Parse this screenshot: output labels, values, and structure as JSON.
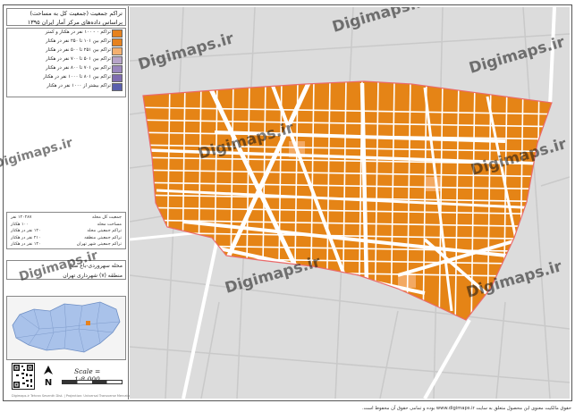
{
  "title": {
    "line1": "تراکم جمعیت (جمعیت کل به مساحت)",
    "line2": "براساس داده‌های مرکز آمار ایران ۱۳۹۵"
  },
  "legend": [
    {
      "label": "تراکم ۰ - ۱۰۰ نفر در هکتار و کمتر",
      "color": "#e6821e"
    },
    {
      "label": "تراکم بین ۱۰۱ تا ۲۵۰ نفر در هکتار",
      "color": "#e6821e"
    },
    {
      "label": "تراکم بین ۲۵۱ تا ۵۰۰ نفر در هکتار",
      "color": "#f3b070"
    },
    {
      "label": "تراکم بین ۵۰۱ تا ۷۰۰ نفر در هکتار",
      "color": "#b7a4c9"
    },
    {
      "label": "تراکم بین ۷۰۱ تا ۸۰۰ نفر در هکتار",
      "color": "#9a86bd"
    },
    {
      "label": "تراکم بین ۸۰۱ تا ۱۰۰۰ نفر در هکتار",
      "color": "#7f6cb0"
    },
    {
      "label": "تراکم بیشتر از ۱۰۰۰ نفر در هکتار",
      "color": "#5a5fad"
    }
  ],
  "stats": [
    {
      "label": "جمعیت کل محله",
      "value": "۱۲۰۲۸۷ نفر"
    },
    {
      "label": "مساحت محله",
      "value": "۱۰۰ هکتار"
    },
    {
      "label": "تراکم جمعیتی محله",
      "value": "۱۲۰ نفر در هکتار"
    },
    {
      "label": "تراکم جمعیتی منطقه",
      "value": "۲۱۰ نفر در هکتار"
    },
    {
      "label": "تراکم جمعیتی شهر تهران",
      "value": "۱۴۰ نفر در هکتار"
    }
  ],
  "district": {
    "line1": "محله سهروردی-باغ صبا",
    "line2": "منطقه (۷) شهرداری تهران"
  },
  "scale": "Scale = 1:8,000",
  "north": "N",
  "credit": "Digimaps.ir   Tehran Seventh Dist. | Projection: Universal Transverse Mercator",
  "watermark": "Digimaps.ir",
  "footer": "حقوق مالکیت معنوی این محصول متعلق به سایت www.digimaps.ir بوده و تمامی حقوق آن محفوظ است.",
  "colors": {
    "block": "#e58416",
    "block_light": "#f3a963",
    "boundary": "#ea6a6a",
    "road": "#ffffff",
    "map_bg": "#dcdcdc",
    "inset_city": "#a9c2ea",
    "inset_district": "#e6821e"
  }
}
